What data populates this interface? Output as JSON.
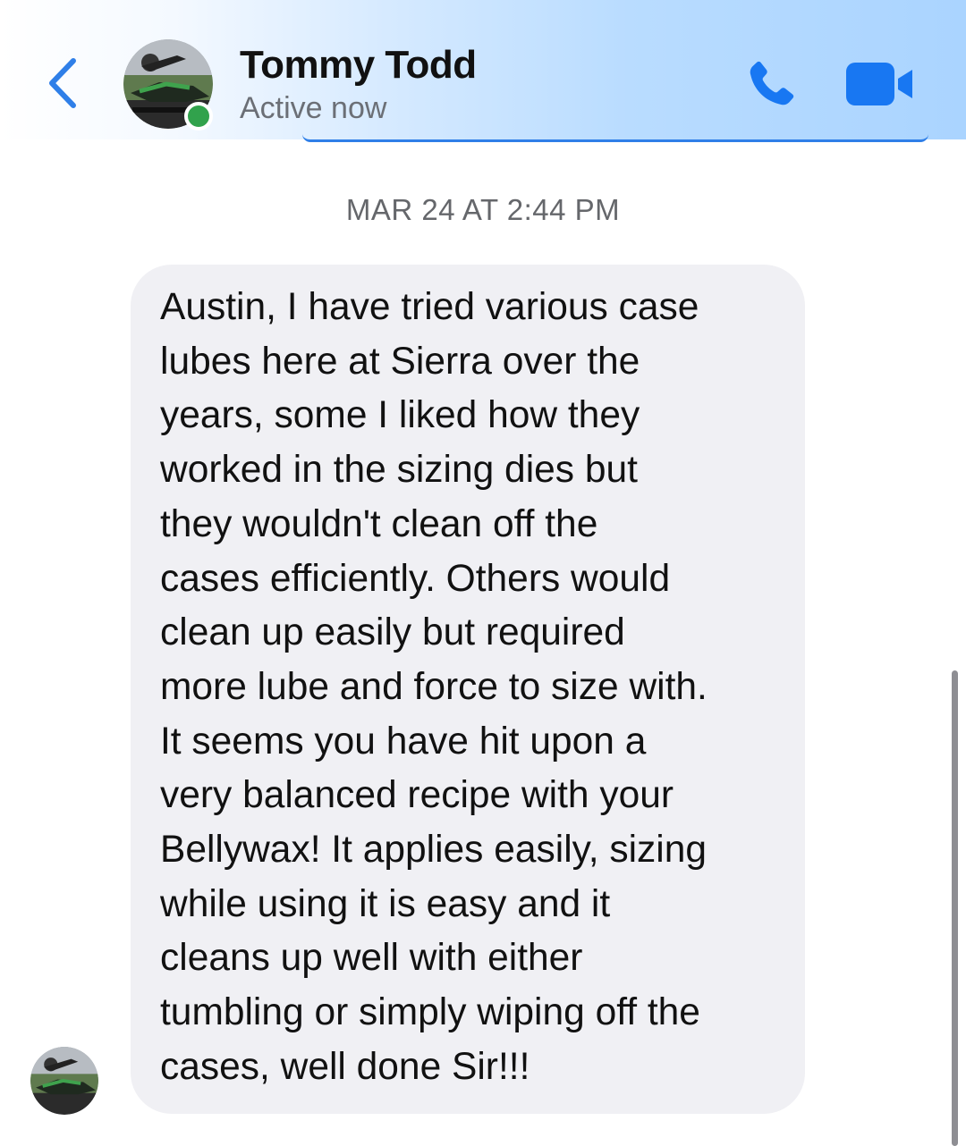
{
  "header": {
    "contact_name": "Tommy Todd",
    "status": "Active now",
    "presence_color": "#31a24c",
    "accent_color": "#1877f2",
    "back_icon": "chevron-left-icon",
    "call_icon": "phone-icon",
    "video_icon": "video-camera-icon"
  },
  "conversation": {
    "timestamp": "MAR 24 AT 2:44 PM",
    "messages": [
      {
        "sender": "Tommy Todd",
        "direction": "incoming",
        "text": "Austin, I have tried various case\nlubes here at Sierra over the\nyears, some I liked how they\nworked in the sizing dies but\nthey wouldn't clean off the\ncases efficiently. Others would\nclean up easily but required\nmore lube and force to size with.\nIt seems you have hit upon a\nvery balanced recipe with your\nBellywax! It applies easily, sizing\nwhile using it is easy and it\ncleans up well with either\ntumbling or simply wiping off the\ncases, well done Sir!!!"
      }
    ]
  }
}
